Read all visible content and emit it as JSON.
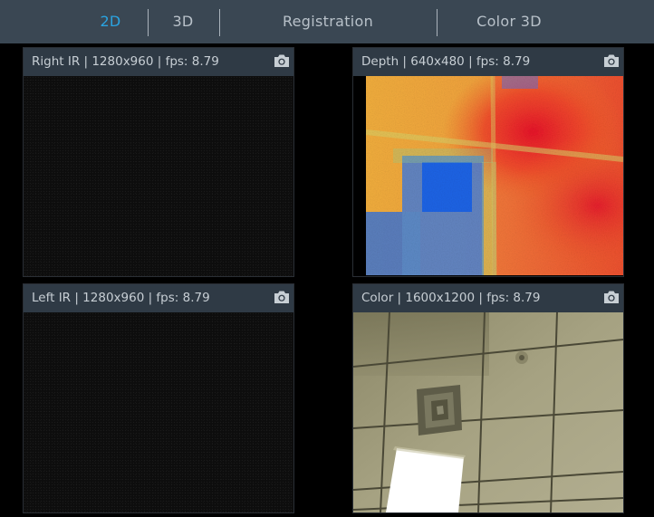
{
  "tabs": [
    {
      "label": "2D",
      "active": true
    },
    {
      "label": "3D",
      "active": false
    },
    {
      "label": "Registration",
      "active": false
    },
    {
      "label": "Color 3D",
      "active": false
    }
  ],
  "panels": {
    "right_ir": {
      "title": "Right IR | 1280x960 | fps: 8.79"
    },
    "depth": {
      "title": "Depth | 640x480 | fps: 8.79"
    },
    "left_ir": {
      "title": "Left IR | 1280x960 | fps: 8.79"
    },
    "color": {
      "title": "Color | 1600x1200 | fps: 8.79"
    }
  },
  "icons": {
    "snapshot": "camera-icon"
  },
  "colors": {
    "topbar_bg": "#3a4753",
    "tab_active": "#2aa3e0",
    "tab_inactive": "#b8c1c9",
    "panel_header_bg": "#2f3a45"
  }
}
